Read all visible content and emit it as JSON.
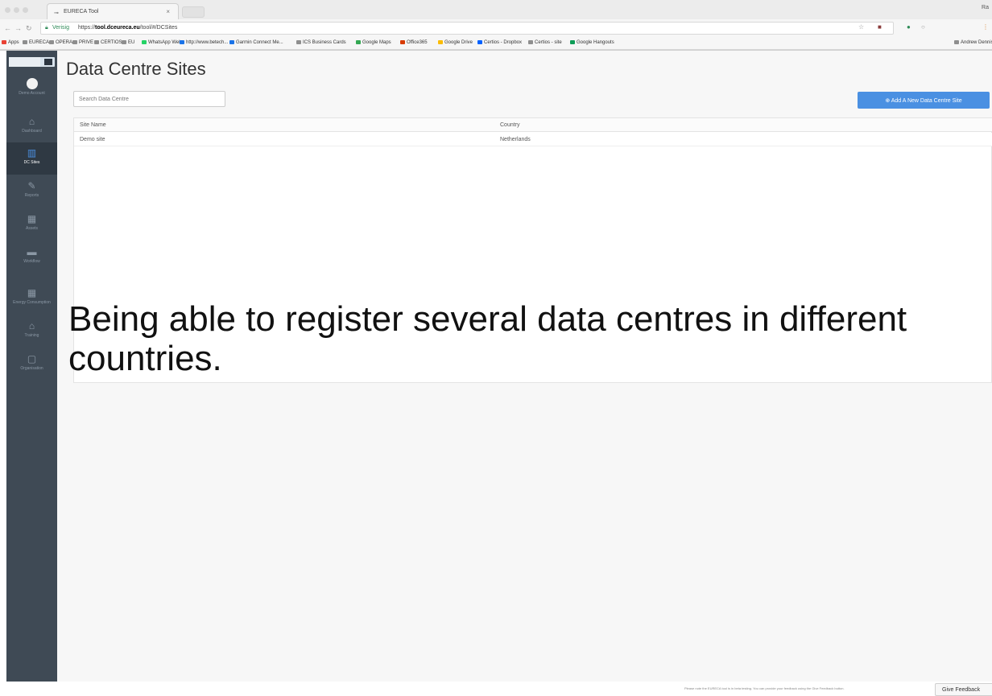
{
  "browser": {
    "tab_title": "EURECA Tool",
    "account_name": "Ra",
    "address": {
      "verified_label": "Verisig",
      "url_prefix": "https://",
      "url_domain": "tool.dceureca.eu",
      "url_path": "/tool/#/DCSites"
    },
    "bookmarks": [
      {
        "label": "Apps",
        "color": "#e94235"
      },
      {
        "label": "EURECA",
        "color": "#8e8e8e"
      },
      {
        "label": "OPERA",
        "color": "#8e8e8e"
      },
      {
        "label": "PRIVE",
        "color": "#8e8e8e"
      },
      {
        "label": "CERTIOS",
        "color": "#8e8e8e"
      },
      {
        "label": "EU",
        "color": "#8e8e8e"
      },
      {
        "label": "WhatsApp Web",
        "color": "#25d366"
      },
      {
        "label": "http://www.betech...",
        "color": "#1a73e8"
      },
      {
        "label": "Garmin Connect Me...",
        "color": "#1a73e8"
      },
      {
        "label": "ICS Business Cards",
        "color": "#8e8e8e"
      },
      {
        "label": "Google Maps",
        "color": "#34a853"
      },
      {
        "label": "Office365",
        "color": "#d83b01"
      },
      {
        "label": "Google Drive",
        "color": "#fbbc04"
      },
      {
        "label": "Certios - Dropbox",
        "color": "#0061ff"
      },
      {
        "label": "Certios - site",
        "color": "#8e8e8e"
      },
      {
        "label": "Google Hangouts",
        "color": "#0f9d58"
      },
      {
        "label": "Andrew Dennison",
        "color": "#8e8e8e"
      }
    ]
  },
  "sidebar": {
    "items": [
      {
        "label": "Demo Account",
        "icon": "avatar-icon"
      },
      {
        "label": "Dashboard",
        "icon": "home-icon",
        "glyph": "⌂"
      },
      {
        "label": "DC Sites",
        "icon": "building-icon",
        "glyph": "▥",
        "active": true
      },
      {
        "label": "Reports",
        "icon": "edit-icon",
        "glyph": "✎"
      },
      {
        "label": "Assets",
        "icon": "server-icon",
        "glyph": "▦"
      },
      {
        "label": "Workflow",
        "icon": "flow-icon",
        "glyph": "▬"
      },
      {
        "label": "Energy Consumption",
        "icon": "grid-icon",
        "glyph": "▦"
      },
      {
        "label": "Training",
        "icon": "bank-icon",
        "glyph": "⌂"
      },
      {
        "label": "Organisation",
        "icon": "org-icon",
        "glyph": "▢"
      }
    ]
  },
  "main": {
    "title": "Data Centre Sites",
    "search_placeholder": "Search Data Centre",
    "add_button": "⊕ Add A New Data Centre Site",
    "columns": [
      "Site Name",
      "Country"
    ],
    "rows": [
      {
        "site_name": "Demo site",
        "country": "Netherlands"
      }
    ]
  },
  "overlay": {
    "line1": "Being able to register several data centres in different",
    "line2": "countries."
  },
  "footer": {
    "note": "Please note the EURECA tool is in beta testing. You can provide your feedback using the Give Feedback button.",
    "feedback_button": "Give Feedback"
  }
}
